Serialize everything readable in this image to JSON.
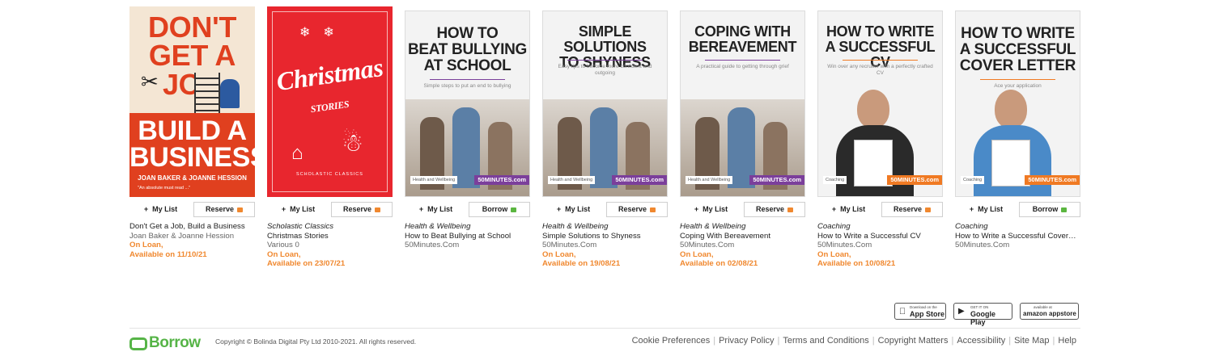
{
  "books": [
    {
      "cover_style": "dont-get-a-job",
      "cover_lines": [
        "DON'T",
        "GET A JOB",
        "BUILD A",
        "BUSINESS"
      ],
      "cover_author": "JOAN BAKER & JOANNE HESSION",
      "cover_quote": "\"An absolute must read ...\"",
      "mylist": "My List",
      "action": "Reserve",
      "action_type": "reserve",
      "series": "",
      "title": "Don't Get a Job, Build a Business",
      "author": "Joan Baker & Joanne Hession",
      "status_line1": "On Loan,",
      "status_line2": "Available on 11/10/21"
    },
    {
      "cover_style": "christmas",
      "cover_lines": [
        "Christmas",
        "STORIES"
      ],
      "cover_publisher": "SCHOLASTIC CLASSICS",
      "mylist": "My List",
      "action": "Reserve",
      "action_type": "reserve",
      "series": "Scholastic Classics",
      "title": "Christmas Stories",
      "author": "Various 0",
      "status_line1": "On Loan,",
      "status_line2": "Available on 23/07/21"
    },
    {
      "cover_style": "50min",
      "cover_lines": [
        "HOW TO",
        "BEAT BULLYING",
        "AT SCHOOL"
      ],
      "cover_sub": "Simple steps to put an end to bullying",
      "cover_tag": "Health and Wellbeing",
      "cover_brand": "50MINUTES.com",
      "mylist": "My List",
      "action": "Borrow",
      "action_type": "borrow",
      "series": "Health & Wellbeing",
      "title": "How to Beat Bullying at School",
      "author": "50Minutes.Com",
      "status_line1": "",
      "status_line2": ""
    },
    {
      "cover_style": "50min",
      "cover_lines": [
        "SIMPLE SOLUTIONS",
        "TO SHYNESS"
      ],
      "cover_sub": "Easy tips to become more confident and outgoing",
      "cover_tag": "Health and Wellbeing",
      "cover_brand": "50MINUTES.com",
      "mylist": "My List",
      "action": "Reserve",
      "action_type": "reserve",
      "series": "Health & Wellbeing",
      "title": "Simple Solutions to Shyness",
      "author": "50Minutes.Com",
      "status_line1": "On Loan,",
      "status_line2": "Available on 19/08/21"
    },
    {
      "cover_style": "50min",
      "cover_lines": [
        "COPING WITH",
        "BEREAVEMENT"
      ],
      "cover_sub": "A practical guide to getting through grief",
      "cover_tag": "Health and Wellbeing",
      "cover_brand": "50MINUTES.com",
      "mylist": "My List",
      "action": "Reserve",
      "action_type": "reserve",
      "series": "Health & Wellbeing",
      "title": "Coping With Bereavement",
      "author": "50Minutes.Com",
      "status_line1": "On Loan,",
      "status_line2": "Available on 02/08/21"
    },
    {
      "cover_style": "50min-coach",
      "cover_lines": [
        "HOW TO WRITE",
        "A SUCCESSFUL CV"
      ],
      "cover_sub": "Win over any recruiter with a perfectly crafted CV",
      "cover_tag": "Coaching",
      "cover_brand": "50MINUTES.com",
      "mylist": "My List",
      "action": "Reserve",
      "action_type": "reserve",
      "series": "Coaching",
      "title": "How to Write a Successful CV",
      "author": "50Minutes.Com",
      "status_line1": "On Loan,",
      "status_line2": "Available on 10/08/21"
    },
    {
      "cover_style": "50min-coach",
      "cover_lines": [
        "HOW TO WRITE",
        "A SUCCESSFUL",
        "COVER LETTER"
      ],
      "cover_sub": "Ace your application",
      "cover_tag": "Coaching",
      "cover_brand": "50MINUTES.com",
      "mylist": "My List",
      "action": "Borrow",
      "action_type": "borrow",
      "series": "Coaching",
      "title": "How to Write a Successful Cover Letter",
      "author": "50Minutes.Com",
      "status_line1": "",
      "status_line2": ""
    }
  ],
  "stores": [
    {
      "small": "Download on the",
      "big": "App Store"
    },
    {
      "small": "GET IT ON",
      "big": "Google Play"
    },
    {
      "small": "available at",
      "big": "amazon appstore"
    }
  ],
  "footer": {
    "logo": "Borrow",
    "copyright": "Copyright © Bolinda Digital Pty Ltd 2010-2021. All rights reserved.",
    "links": [
      "Cookie Preferences",
      "Privacy Policy",
      "Terms and Conditions",
      "Copyright Matters",
      "Accessibility",
      "Site Map",
      "Help"
    ]
  },
  "colors": {
    "accent_orange": "#f0882f",
    "accent_green": "#56b447",
    "brand_purple": "#7b3f9b",
    "brand_orange": "#f07a23"
  }
}
